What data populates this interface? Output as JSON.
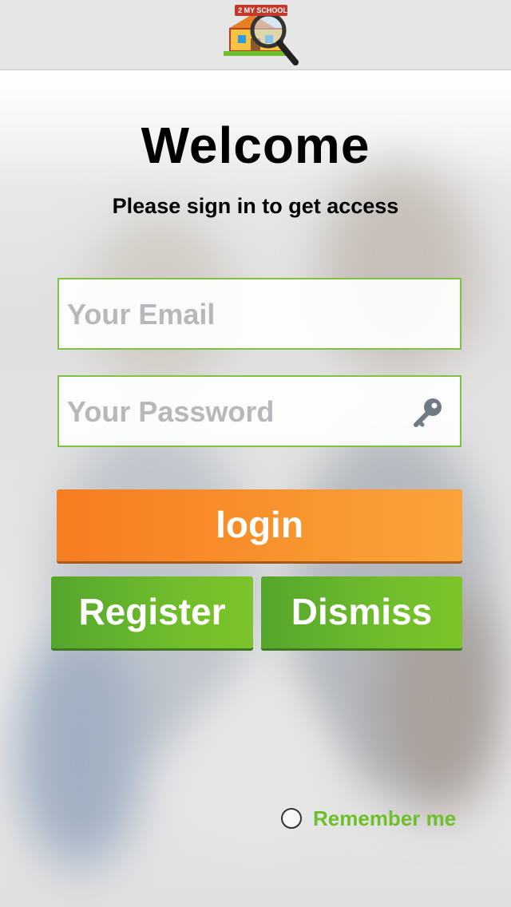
{
  "header": {
    "logo_text": "2 MY SCHOOL"
  },
  "welcome": {
    "title": "Welcome",
    "subtitle": "Please sign in to get access"
  },
  "form": {
    "email_placeholder": "Your Email",
    "password_placeholder": "Your Password",
    "password_icon": "key-icon",
    "login_label": "login",
    "register_label": "Register",
    "dismiss_label": "Dismiss",
    "remember_label": "Remember me"
  },
  "colors": {
    "accent_green": "#7fc242",
    "login_orange": "#f8952e",
    "remember_green": "#6fbe2c",
    "placeholder_gray": "#b8b8bc"
  }
}
